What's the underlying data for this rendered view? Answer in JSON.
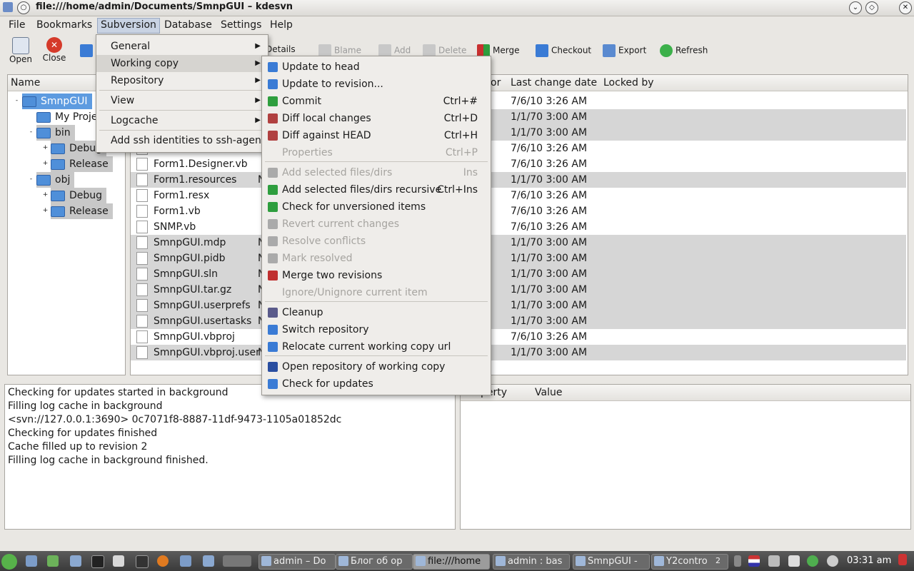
{
  "window": {
    "title": "file:///home/admin/Documents/SmnpGUI – kdesvn"
  },
  "menubar": [
    "File",
    "Bookmarks",
    "Subversion",
    "Database",
    "Settings",
    "Help"
  ],
  "toolbar": {
    "open": "Open",
    "close": "Close",
    "details": "Details",
    "blame": "Blame",
    "add": "Add",
    "delete": "Delete",
    "merge": "Merge",
    "checkout": "Checkout",
    "export": "Export",
    "refresh": "Refresh"
  },
  "tree": {
    "header": "Name",
    "items": [
      {
        "label": "SmnpGUI",
        "level": 0,
        "toggle": "-"
      },
      {
        "label": "My Proje",
        "level": 1,
        "toggle": ""
      },
      {
        "label": "bin",
        "level": 1,
        "toggle": "-"
      },
      {
        "label": "Debug",
        "level": 2,
        "toggle": "+"
      },
      {
        "label": "Release",
        "level": 2,
        "toggle": "+"
      },
      {
        "label": "obj",
        "level": 1,
        "toggle": "-"
      },
      {
        "label": "Debug",
        "level": 2,
        "toggle": "+"
      },
      {
        "label": "Release",
        "level": 2,
        "toggle": "+"
      }
    ]
  },
  "files": {
    "headers": {
      "author": "or",
      "date": "Last change date",
      "locked": "Locked by"
    },
    "rows": [
      {
        "name": "",
        "flag": "",
        "date": "7/6/10 3:26 AM",
        "sel": false
      },
      {
        "name": "",
        "flag": "",
        "date": "1/1/70 3:00 AM",
        "sel": true
      },
      {
        "name": "",
        "flag": "",
        "date": "1/1/70 3:00 AM",
        "sel": true
      },
      {
        "name": "",
        "flag": "",
        "date": "7/6/10 3:26 AM",
        "sel": false
      },
      {
        "name": "Form1.Designer.vb",
        "flag": "",
        "date": "7/6/10 3:26 AM",
        "sel": false
      },
      {
        "name": "Form1.resources",
        "flag": "N",
        "date": "1/1/70 3:00 AM",
        "sel": true
      },
      {
        "name": "Form1.resx",
        "flag": "",
        "date": "7/6/10 3:26 AM",
        "sel": false
      },
      {
        "name": "Form1.vb",
        "flag": "",
        "date": "7/6/10 3:26 AM",
        "sel": false
      },
      {
        "name": "SNMP.vb",
        "flag": "",
        "date": "7/6/10 3:26 AM",
        "sel": false
      },
      {
        "name": "SmnpGUI.mdp",
        "flag": "N",
        "date": "1/1/70 3:00 AM",
        "sel": true
      },
      {
        "name": "SmnpGUI.pidb",
        "flag": "N",
        "date": "1/1/70 3:00 AM",
        "sel": true
      },
      {
        "name": "SmnpGUI.sln",
        "flag": "N",
        "date": "1/1/70 3:00 AM",
        "sel": true
      },
      {
        "name": "SmnpGUI.tar.gz",
        "flag": "N",
        "date": "1/1/70 3:00 AM",
        "sel": true
      },
      {
        "name": "SmnpGUI.userprefs",
        "flag": "N",
        "date": "1/1/70 3:00 AM",
        "sel": true
      },
      {
        "name": "SmnpGUI.usertasks",
        "flag": "N",
        "date": "1/1/70 3:00 AM",
        "sel": true
      },
      {
        "name": "SmnpGUI.vbproj",
        "flag": "",
        "date": "7/6/10 3:26 AM",
        "sel": false
      },
      {
        "name": "SmnpGUI.vbproj.user",
        "flag": "N",
        "date": "1/1/70 3:00 AM",
        "sel": true
      }
    ]
  },
  "subversion_menu": [
    "General",
    "Working copy",
    "Repository",
    "View",
    "Logcache",
    "Add ssh identities to ssh-agent"
  ],
  "working_copy_menu": [
    {
      "label": "Update to head",
      "shortcut": "",
      "enabled": true,
      "color": "#3a7bd5"
    },
    {
      "label": "Update to revision...",
      "shortcut": "",
      "enabled": true,
      "color": "#3a7bd5"
    },
    {
      "label": "Commit",
      "shortcut": "Ctrl+#",
      "enabled": true,
      "color": "#2e9e3e"
    },
    {
      "label": "Diff local changes",
      "shortcut": "Ctrl+D",
      "enabled": true,
      "color": "#b04040"
    },
    {
      "label": "Diff against HEAD",
      "shortcut": "Ctrl+H",
      "enabled": true,
      "color": "#b04040"
    },
    {
      "label": "Properties",
      "shortcut": "Ctrl+P",
      "enabled": false,
      "color": ""
    },
    {
      "label": "Add selected files/dirs",
      "shortcut": "Ins",
      "enabled": false,
      "color": "#aaaaaa"
    },
    {
      "label": "Add selected files/dirs recursive",
      "shortcut": "Ctrl+Ins",
      "enabled": true,
      "color": "#2e9e3e"
    },
    {
      "label": "Check for unversioned items",
      "shortcut": "",
      "enabled": true,
      "color": "#2e9e3e"
    },
    {
      "label": "Revert current changes",
      "shortcut": "",
      "enabled": false,
      "color": "#aaaaaa"
    },
    {
      "label": "Resolve conflicts",
      "shortcut": "",
      "enabled": false,
      "color": "#aaaaaa"
    },
    {
      "label": "Mark resolved",
      "shortcut": "",
      "enabled": false,
      "color": "#aaaaaa"
    },
    {
      "label": "Merge two revisions",
      "shortcut": "",
      "enabled": true,
      "color": "#c03030"
    },
    {
      "label": "Ignore/Unignore current item",
      "shortcut": "",
      "enabled": false,
      "color": ""
    },
    {
      "label": "Cleanup",
      "shortcut": "",
      "enabled": true,
      "color": "#5a5a8a"
    },
    {
      "label": "Switch repository",
      "shortcut": "",
      "enabled": true,
      "color": "#3a7bd5"
    },
    {
      "label": "Relocate current working copy url",
      "shortcut": "",
      "enabled": true,
      "color": "#3a7bd5"
    },
    {
      "label": "Open repository of working copy",
      "shortcut": "",
      "enabled": true,
      "color": "#2a4ea0"
    },
    {
      "label": "Check for updates",
      "shortcut": "",
      "enabled": true,
      "color": "#3a7bd5"
    }
  ],
  "log": [
    "Checking for updates started in background",
    "Filling log cache in background",
    "<svn://127.0.0.1:3690> 0c7071f8-8887-11df-9473-1105a01852dc",
    "Checking for updates finished",
    "Cache filled up to revision 2",
    "Filling log cache in background finished."
  ],
  "props": {
    "col_property": "perty",
    "col_value": "Value"
  },
  "taskbar": {
    "tasks": [
      "admin – Do",
      "Блог об ор",
      "file:///home",
      "admin : bas",
      "SmnpGUI -",
      "Y2contro"
    ],
    "pager": "2",
    "clock": "03:31 am"
  }
}
